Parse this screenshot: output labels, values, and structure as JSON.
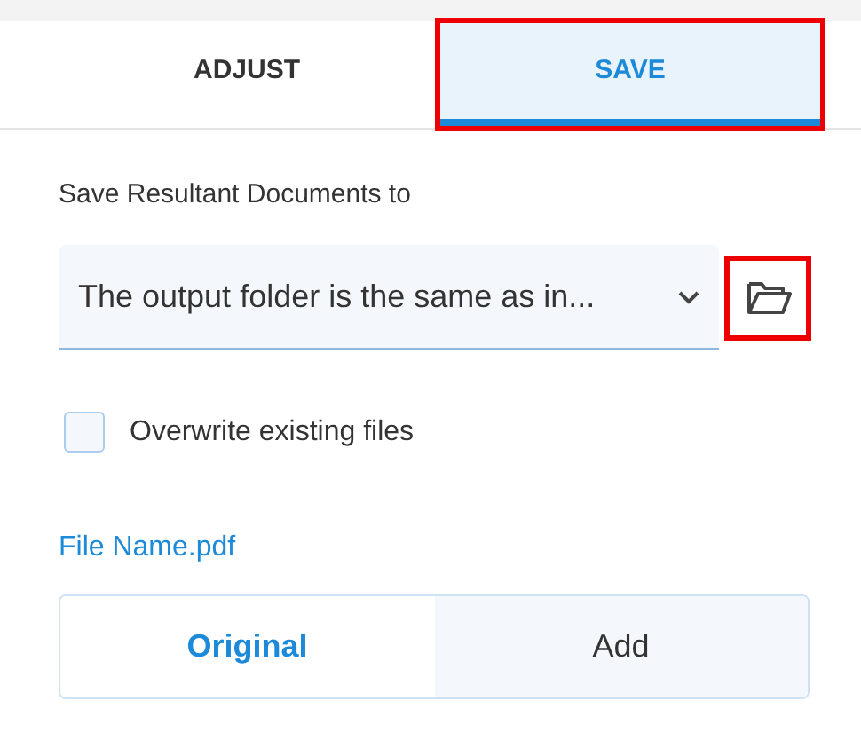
{
  "tabs": [
    {
      "label": "ADJUST",
      "selected": false,
      "highlighted": false
    },
    {
      "label": "SAVE",
      "selected": true,
      "highlighted": true
    }
  ],
  "save_location": {
    "label": "Save Resultant Documents to",
    "value": "The output folder is the same as in...",
    "browse_highlighted": true
  },
  "overwrite": {
    "label": "Overwrite existing files",
    "checked": false
  },
  "file_name": "File Name.pdf",
  "name_mode": [
    {
      "label": "Original",
      "selected": true
    },
    {
      "label": "Add",
      "selected": false
    }
  ]
}
